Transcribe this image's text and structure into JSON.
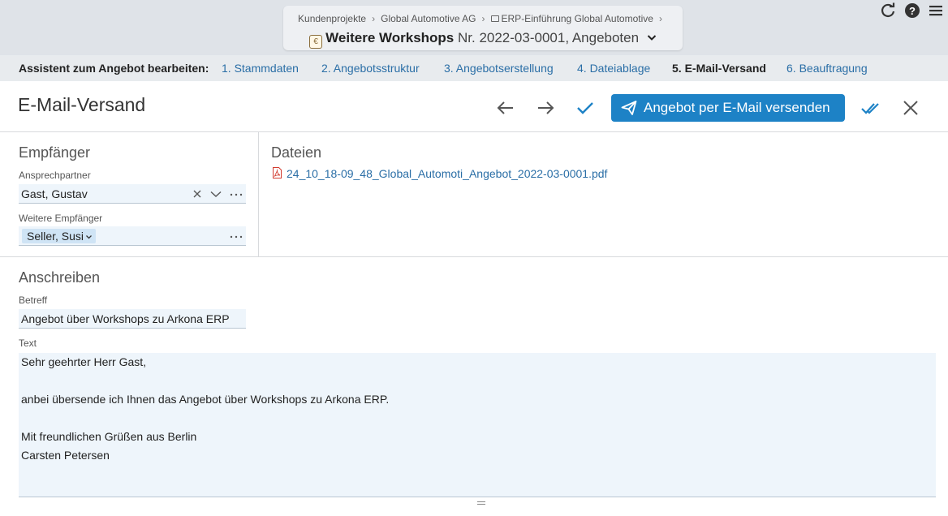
{
  "breadcrumb": {
    "items": [
      "Kundenprojekte",
      "Global Automotive AG",
      "ERP-Einführung Global Automotive"
    ],
    "separator": "›"
  },
  "record": {
    "name": "Weitere Workshops",
    "number": "Nr. 2022-03-0001, Angeboten"
  },
  "wizard": {
    "label": "Assistent zum Angebot bearbeiten:",
    "steps": [
      "1. Stammdaten",
      "2. Angebotsstruktur",
      "3. Angebotserstellung",
      "4. Dateiablage",
      "5. E-Mail-Versand",
      "6. Beauftragung"
    ],
    "active_index": 4
  },
  "page": {
    "title": "E-Mail-Versand",
    "send_button": "Angebot per E-Mail versenden"
  },
  "recipients": {
    "heading": "Empfänger",
    "contact_label": "Ansprechpartner",
    "contact_value": "Gast, Gustav",
    "more_label": "Weitere Empfänger",
    "more_chip": "Seller, Susi"
  },
  "files": {
    "heading": "Dateien",
    "items": [
      "24_10_18-09_48_Global_Automoti_Angebot_2022-03-0001.pdf"
    ]
  },
  "letter": {
    "heading": "Anschreiben",
    "subject_label": "Betreff",
    "subject_value": "Angebot über Workshops zu Arkona ERP",
    "text_label": "Text",
    "text_lines": [
      "Sehr geehrter Herr Gast,",
      "",
      "anbei übersende ich Ihnen das Angebot über Workshops zu Arkona ERP.",
      "",
      "Mit freundlichen Grüßen aus Berlin",
      "Carsten Petersen"
    ]
  },
  "colors": {
    "accent": "#1d82c6",
    "link": "#2a6ea6",
    "field_bg": "#eef5fb",
    "header_bg": "#dfe3e8"
  }
}
